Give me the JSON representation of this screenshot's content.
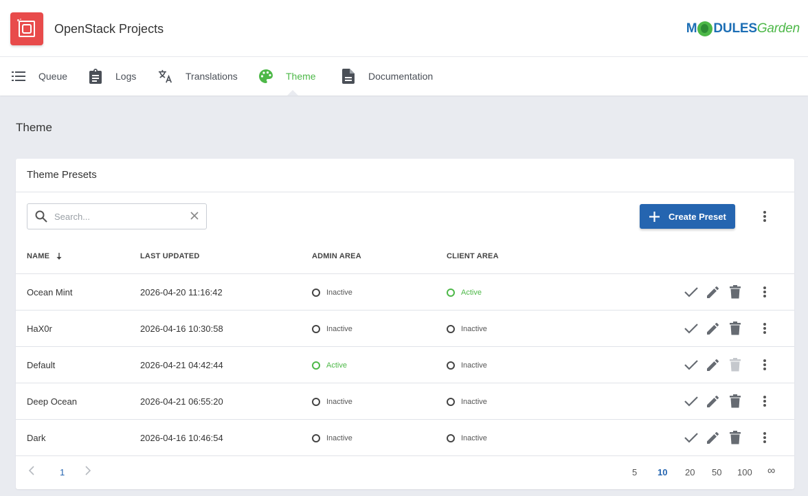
{
  "header": {
    "title": "OpenStack Projects",
    "brand_part1": "M",
    "brand_part2": "DULES",
    "brand_part3": "Garden"
  },
  "nav": {
    "items": [
      {
        "label": "Queue",
        "icon": "list-icon"
      },
      {
        "label": "Logs",
        "icon": "clipboard-icon"
      },
      {
        "label": "Translations",
        "icon": "translate-icon"
      },
      {
        "label": "Theme",
        "icon": "palette-icon",
        "active": true
      },
      {
        "label": "Documentation",
        "icon": "document-icon"
      }
    ]
  },
  "page": {
    "title": "Theme"
  },
  "card": {
    "title": "Theme Presets",
    "search_placeholder": "Search...",
    "search_value": "",
    "create_label": "Create Preset"
  },
  "table": {
    "columns": {
      "name": "NAME",
      "last_updated": "LAST UPDATED",
      "admin_area": "ADMIN AREA",
      "client_area": "CLIENT AREA"
    },
    "rows": [
      {
        "name": "Ocean Mint",
        "updated": "2026-04-20 11:16:42",
        "admin": "Inactive",
        "client": "Active",
        "delete_disabled": false
      },
      {
        "name": "HaX0r",
        "updated": "2026-04-16 10:30:58",
        "admin": "Inactive",
        "client": "Inactive",
        "delete_disabled": false
      },
      {
        "name": "Default",
        "updated": "2026-04-21 04:42:44",
        "admin": "Active",
        "client": "Inactive",
        "delete_disabled": true
      },
      {
        "name": "Deep Ocean",
        "updated": "2026-04-21 06:55:20",
        "admin": "Inactive",
        "client": "Inactive",
        "delete_disabled": false
      },
      {
        "name": "Dark",
        "updated": "2026-04-16 10:46:54",
        "admin": "Inactive",
        "client": "Inactive",
        "delete_disabled": false
      }
    ]
  },
  "pagination": {
    "current_page": "1",
    "page_sizes": [
      "5",
      "10",
      "20",
      "50",
      "100",
      "∞"
    ],
    "selected_size": "10"
  },
  "colors": {
    "accent_green": "#4db848",
    "primary_blue": "#2565b0",
    "logo_red": "#e84b4b"
  }
}
